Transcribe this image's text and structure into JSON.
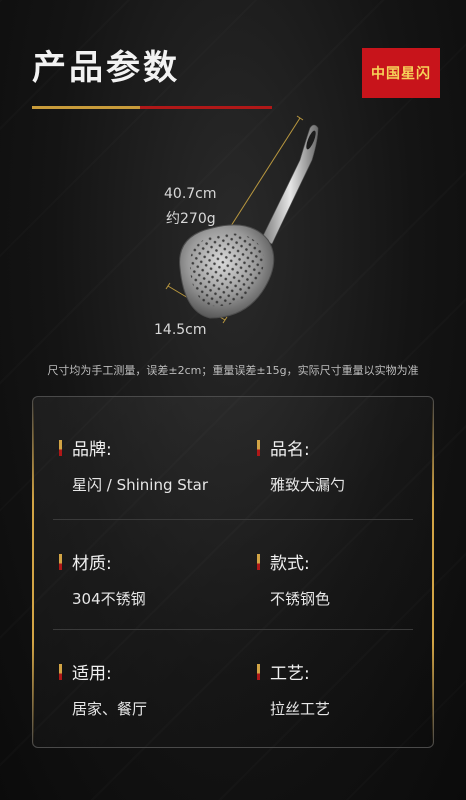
{
  "header": {
    "title": "产品参数",
    "logo_text": "中国星闪"
  },
  "product_image": {
    "length_label": "40.7cm",
    "weight_label": "约270g",
    "width_label": "14.5cm"
  },
  "note": "尺寸均为手工测量，误差±2cm；重量误差±15g，实际尺寸重量以实物为准",
  "specs": [
    {
      "label": "品牌:",
      "value": "星闪 / Shining Star"
    },
    {
      "label": "品名:",
      "value": "雅致大漏勺"
    },
    {
      "label": "材质:",
      "value": "304不锈钢"
    },
    {
      "label": "款式:",
      "value": "不锈钢色"
    },
    {
      "label": "适用:",
      "value": "居家、餐厅"
    },
    {
      "label": "工艺:",
      "value": "拉丝工艺"
    }
  ],
  "colors": {
    "accent_gold": "#c89b3a",
    "accent_red": "#b01818",
    "logo_bg": "#c8141b"
  }
}
